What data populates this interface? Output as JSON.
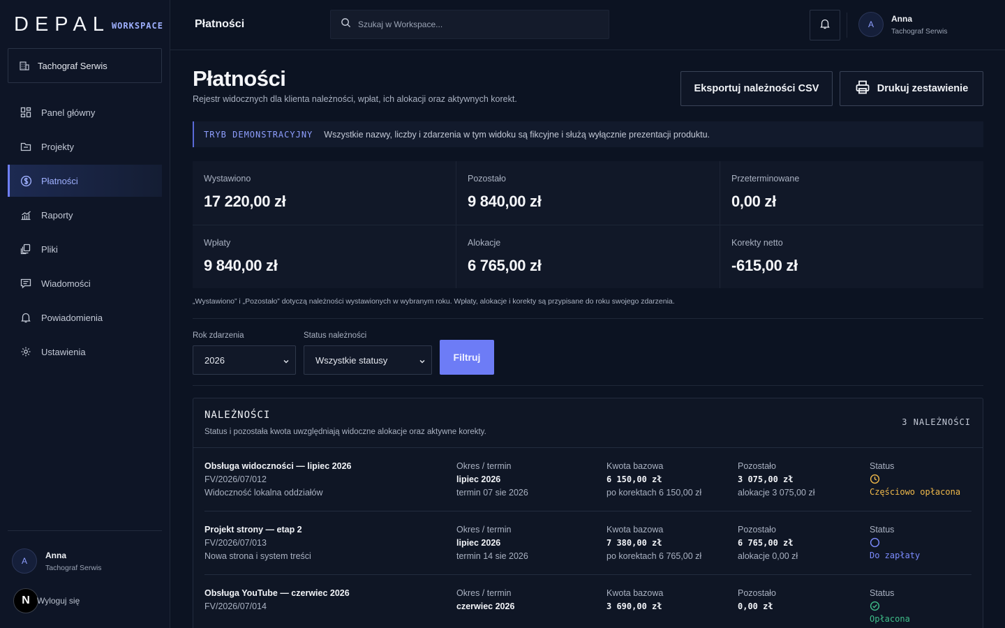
{
  "brand": {
    "name": "DEPAL",
    "suffix": "WORKSPACE"
  },
  "tenant": "Tachograf Serwis",
  "nav": [
    {
      "label": "Panel główny",
      "icon": "dashboard-icon"
    },
    {
      "label": "Projekty",
      "icon": "folder-icon"
    },
    {
      "label": "Płatności",
      "icon": "dollar-icon",
      "active": true
    },
    {
      "label": "Raporty",
      "icon": "chart-icon"
    },
    {
      "label": "Pliki",
      "icon": "files-icon"
    },
    {
      "label": "Wiadomości",
      "icon": "message-icon"
    },
    {
      "label": "Powiadomienia",
      "icon": "bell-icon"
    },
    {
      "label": "Ustawienia",
      "icon": "gear-icon"
    }
  ],
  "user": {
    "initial": "A",
    "name": "Anna",
    "org": "Tachograf Serwis"
  },
  "logout_label": "Wyloguj się",
  "n_badge": "N",
  "topbar": {
    "title": "Płatności",
    "search_placeholder": "Szukaj w Workspace..."
  },
  "page": {
    "title": "Płatności",
    "subtitle": "Rejestr widocznych dla klienta należności, wpłat, ich alokacji oraz aktywnych korekt.",
    "export_label": "Eksportuj należności CSV",
    "print_label": "Drukuj zestawienie"
  },
  "demo": {
    "tag": "TRYB DEMONSTRACYJNY",
    "text": "Wszystkie nazwy, liczby i zdarzenia w tym widoku są fikcyjne i służą wyłącznie prezentacji produktu."
  },
  "stats": [
    {
      "label": "Wystawiono",
      "value": "17 220,00 zł"
    },
    {
      "label": "Pozostało",
      "value": "9 840,00 zł"
    },
    {
      "label": "Przeterminowane",
      "value": "0,00 zł"
    },
    {
      "label": "Wpłaty",
      "value": "9 840,00 zł"
    },
    {
      "label": "Alokacje",
      "value": "6 765,00 zł"
    },
    {
      "label": "Korekty netto",
      "value": "-615,00 zł"
    }
  ],
  "stats_note": "„Wystawiono” i „Pozostało” dotyczą należności wystawionych w wybranym roku. Wpłaty, alokacje i korekty są przypisane do roku swojego zdarzenia.",
  "filters": {
    "year_label": "Rok zdarzenia",
    "year_value": "2026",
    "status_label": "Status należności",
    "status_value": "Wszystkie statusy",
    "submit_label": "Filtruj"
  },
  "panel": {
    "title": "NALEŻNOŚCI",
    "subtitle": "Status i pozostała kwota uwzględniają widoczne alokacje oraz aktywne korekty.",
    "count": "3 NALEŻNOŚCI",
    "rows": [
      {
        "title": "Obsługa widoczności — lipiec 2026",
        "number": "FV/2026/07/012",
        "desc": "Widoczność lokalna oddziałów",
        "period_label": "Okres / termin",
        "period": "lipiec 2026",
        "due": "termin 07 sie 2026",
        "base_label": "Kwota bazowa",
        "base": "6 150,00 zł",
        "after": "po korektach 6 150,00 zł",
        "left_label": "Pozostało",
        "left": "3 075,00 zł",
        "alloc": "alokacje 3 075,00 zł",
        "status_label": "Status",
        "status": "Częściowo opłacona",
        "status_color": "#f0b94a"
      },
      {
        "title": "Projekt strony — etap 2",
        "number": "FV/2026/07/013",
        "desc": "Nowa strona i system treści",
        "period_label": "Okres / termin",
        "period": "lipiec 2026",
        "due": "termin 14 sie 2026",
        "base_label": "Kwota bazowa",
        "base": "7 380,00 zł",
        "after": "po korektach 6 765,00 zł",
        "left_label": "Pozostało",
        "left": "6 765,00 zł",
        "alloc": "alokacje 0,00 zł",
        "status_label": "Status",
        "status": "Do zapłaty",
        "status_color": "#7c8cff"
      },
      {
        "title": "Obsługa YouTube — czerwiec 2026",
        "number": "FV/2026/07/014",
        "desc": "",
        "period_label": "Okres / termin",
        "period": "czerwiec 2026",
        "due": "",
        "base_label": "Kwota bazowa",
        "base": "3 690,00 zł",
        "after": "",
        "left_label": "Pozostało",
        "left": "0,00 zł",
        "alloc": "",
        "status_label": "Status",
        "status": "Opłacona",
        "status_color": "#3fbf8a"
      }
    ]
  }
}
